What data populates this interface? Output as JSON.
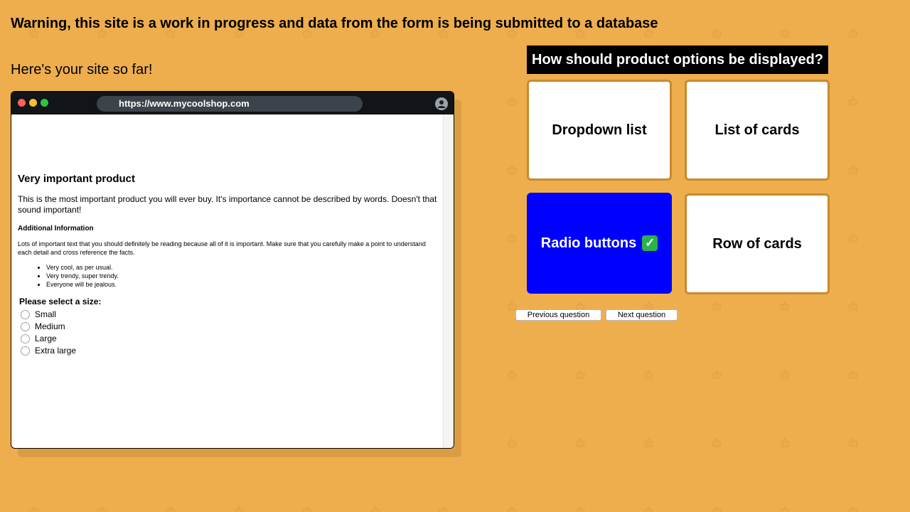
{
  "warning": "Warning, this site is a work in progress and data from the form is being submitted to a database",
  "preview_heading": "Here's your site so far!",
  "browser": {
    "url": "https://www.mycoolshop.com",
    "product_title": "Very important product",
    "product_description": "This is the most important product you will ever buy. It's importance cannot be described by words. Doesn't that sound important!",
    "additional_heading": "Additional Information",
    "additional_text": "Lots of important text that you should definitely be reading because all of it is important. Make sure that you carefully make a point to understand each detail and cross reference the facts.",
    "bullets": [
      "Very cool, as per usual.",
      "Very trendy, super trendy.",
      "Everyone will be jealous."
    ],
    "size_legend": "Please select a size:",
    "sizes": [
      "Small",
      "Medium",
      "Large",
      "Extra large"
    ]
  },
  "question": {
    "heading": "How should product options be displayed?",
    "options": [
      "Dropdown list",
      "List of cards",
      "Radio buttons",
      "Row of cards"
    ],
    "selected_index": 2,
    "selected_mark": "✓",
    "previous_label": "Previous question",
    "next_label": "Next question"
  },
  "colors": {
    "background": "#EEAE4D",
    "selected_card": "#0000FF",
    "card_border": "#C98A2E"
  },
  "icons": {
    "background_pattern": "basket-icon",
    "profile": "user-icon"
  }
}
